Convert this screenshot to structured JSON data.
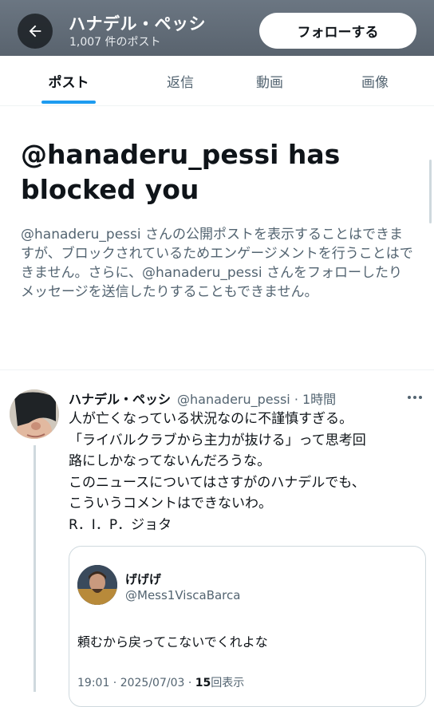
{
  "header": {
    "title": "ハナデル・ペッシ",
    "post_count": "1,007 件のポスト",
    "follow_label": "フォローする"
  },
  "tabs": [
    {
      "label": "ポスト",
      "active": true
    },
    {
      "label": "返信",
      "active": false
    },
    {
      "label": "動画",
      "active": false
    },
    {
      "label": "画像",
      "active": false
    }
  ],
  "blocked": {
    "title": "@hanaderu_pessi has blocked you",
    "description": "@hanaderu_pessi さんの公開ポストを表示することはできますが、ブロックされているためエンゲージメントを行うことはできません。さらに、@hanaderu_pessi さんをフォローしたりメッセージを送信したりすることもできません。"
  },
  "tweet": {
    "name": "ハナデル・ペッシ",
    "handle_time": "@hanaderu_pessi · 1時間",
    "lines": [
      "人が亡くなっている状況なのに不謹慎すぎる。",
      "「ライバルクラブから主力が抜ける」って思考回",
      "路にしかなってないんだろうな。",
      "このニュースについてはさすがのハナデルでも、",
      "こういうコメントはできないわ。",
      "R．I．P．ジョタ"
    ]
  },
  "quote": {
    "name": "げげげ",
    "handle": "@Mess1ViscaBarca",
    "text": "頼むから戻ってこないでくれよな",
    "meta_prefix": "19:01 · 2025/07/03 · ",
    "views": "15",
    "views_suffix": "回表示"
  },
  "icons": {
    "back": "arrow-left-icon",
    "more": "more-horizontal-icon"
  },
  "colors": {
    "accent": "#1d9bf0",
    "secondary_text": "#536471",
    "header_bg": "#616c77"
  }
}
